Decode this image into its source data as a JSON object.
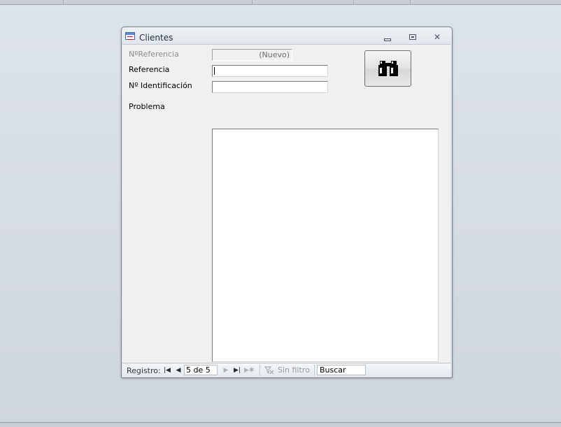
{
  "window": {
    "title": "Clientes"
  },
  "form": {
    "fields": [
      {
        "label": "NºReferencia",
        "value": "(Nuevo)"
      },
      {
        "label": "Referencia",
        "value": ""
      },
      {
        "label": "Nº Identificación",
        "value": ""
      },
      {
        "label": "Problema",
        "value": ""
      }
    ]
  },
  "navigation": {
    "label": "Registro:",
    "record": "5 de 5",
    "filter": "Sin filtro",
    "search_placeholder": "Buscar"
  }
}
